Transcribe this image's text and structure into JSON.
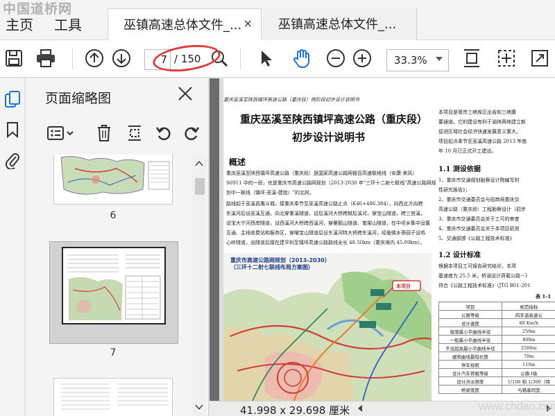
{
  "watermark_top": "中国道桥网",
  "watermark_bottom": "www.chdao.com",
  "menu": {
    "home": "主页",
    "tools": "工具"
  },
  "tabs": [
    {
      "label": "巫镇高速总体文件_...",
      "close": "×"
    },
    {
      "label": "巫镇高速总体文件_..."
    }
  ],
  "toolbar": {
    "page_current": "7",
    "page_total": "/ 150",
    "zoom": "33.3%"
  },
  "icons": {
    "save": "save-icon",
    "print": "print-icon",
    "prev": "arrow-up-icon",
    "next": "arrow-down-icon",
    "select": "pointer-icon",
    "hand": "hand-icon",
    "zoom_out": "zoom-out-icon",
    "zoom_in": "zoom-in-icon",
    "fit_page": "fit-page-icon",
    "fit_width": "fit-width-icon",
    "fullscreen": "fullscreen-icon"
  },
  "colors": {
    "accent": "#1473e6",
    "oval": "#e33a3a",
    "map_blue": "#1e3d8c"
  },
  "panel": {
    "title": "页面缩略图",
    "thumbs": [
      {
        "label": "6"
      },
      {
        "label": "7"
      }
    ]
  },
  "document": {
    "header": "重庆巫溪至陕西镇坪高速公路（重庆段）两阶段初步设计说明书",
    "title_line1": "重庆巫溪至陕西镇坪高速公路（重庆段）",
    "title_line2": "初步设计说明书",
    "section": "概述",
    "para": [
      "重庆巫溪至陕西镇坪高速公路（重庆段）是国家高速公路网银百高速联络线（安康-来凤）",
      "S6911 中的一段，也是重庆市高速公路网规划（2013-2030 年\"三环十二射七联线\"高速公路网规",
      "划中一联线（镇坪-巫溪-建始）\"的北段。",
      "路线起于巫溪县鹰斗城，接重庆奉节至巫溪高速公路止点（K46+486.384），向西北方向跨",
      "东溪河后设巫溪互通，向北穿重溪隧道，设后溪河大桥跨越后溪河，穿宝山隧道，跨三宫溪，",
      "设宝大宁河西岸隧道，设西溪河大桥跨西溪河，穿雁鹅山隧道、笔架山隧道，在中坝乡集中设置",
      "互通、主线收费站和服务区，穿曜宝山隧道后设东溪河特大桥跨东溪河，经鱼鳞乡荼园子设鸡",
      "心岭隧道，出隧道后接在建平利至镇坪高速公路路线全长 48.50km（重庆境内 45.09km）。"
    ],
    "map_title_1": "重庆市高速公路网规划（2013-2030）",
    "map_title_2": "（三环十二射七联线布局方案图）",
    "map_label": "本项目",
    "right": {
      "para1": [
        "本项目是我市三峡库区出省和三峡腹",
        "要通道。它的建设有利于渝陕两地建立新",
        "促进区域社会经济快速发展意义重大。",
        "项目起点奉节至巫溪高速公路 2013 年底",
        "年 10 月已正式开工建设。"
      ],
      "h_basis": "1.1  测设依据",
      "basis": [
        "1、重庆市交通规划勘察设计院编写的",
        "性研究报告》；",
        "2、重庆市交通委员会与招商局重庆交",
        "高速公路（重庆段）工程勘察设计（初步",
        "3、重庆市交通委员会关于工可的审查",
        "4、重庆市交通委员会关于本项目初测",
        "5、交通部颁《公路工程技术标准》"
      ],
      "h_standard": "1.2  设计标准",
      "standard": [
        "根据本项目工可报告研究结论，本项",
        "基速度为 25.5 米，桥涵设计荷载公路－Ⅰ",
        "符合《公路工程技术标准》（JTG B01-201"
      ],
      "table_caption": "表 1-1",
      "table": [
        [
          "项目",
          "规范指标"
        ],
        [
          "公路等级",
          "四车道高速公"
        ],
        [
          "设计速度",
          "80 Km/h"
        ],
        [
          "极限最小平曲线半径",
          "250m"
        ],
        [
          "一般最小平曲线半径",
          "400m"
        ],
        [
          "不设超高最小平曲线半径",
          "2500m"
        ],
        [
          "缓和曲线最短长度",
          "70m"
        ],
        [
          "停车视距",
          "110m"
        ],
        [
          "设计汽车荷载等级",
          "公路-Ⅰ级"
        ],
        [
          "设计洪水频率",
          "1/100 和 1/300（特"
        ],
        [
          "桥梁宽度",
          "与路基同宽"
        ]
      ]
    }
  },
  "status": {
    "dimensions": "41.998 x 29.698 厘米"
  }
}
